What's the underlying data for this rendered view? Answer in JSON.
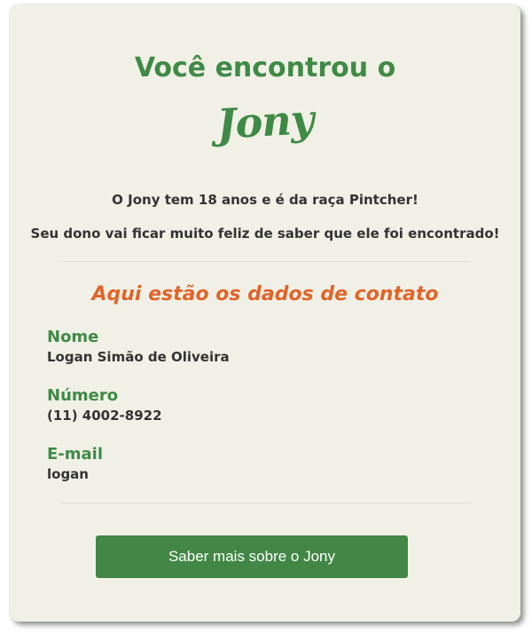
{
  "header": {
    "title": "Você encontrou o",
    "pet_name": "Jony"
  },
  "info": {
    "line1": "O Jony tem 18 anos e é da raça Pintcher!",
    "line2": "Seu dono vai ficar muito feliz de saber que ele foi encontrado!"
  },
  "contact": {
    "title": "Aqui estão os dados de contato",
    "fields": [
      {
        "label": "Nome",
        "value": "Logan Simão de Oliveira"
      },
      {
        "label": "Número",
        "value": "(11) 4002-8922"
      },
      {
        "label": "E-mail",
        "value": "logan"
      }
    ]
  },
  "cta": {
    "label": "Saber mais sobre o Jony"
  },
  "colors": {
    "background": "#f1f0e6",
    "brand_green": "#3f8a46",
    "accent_orange": "#e0652a",
    "text_dark": "#333333",
    "button_green": "#428745"
  }
}
